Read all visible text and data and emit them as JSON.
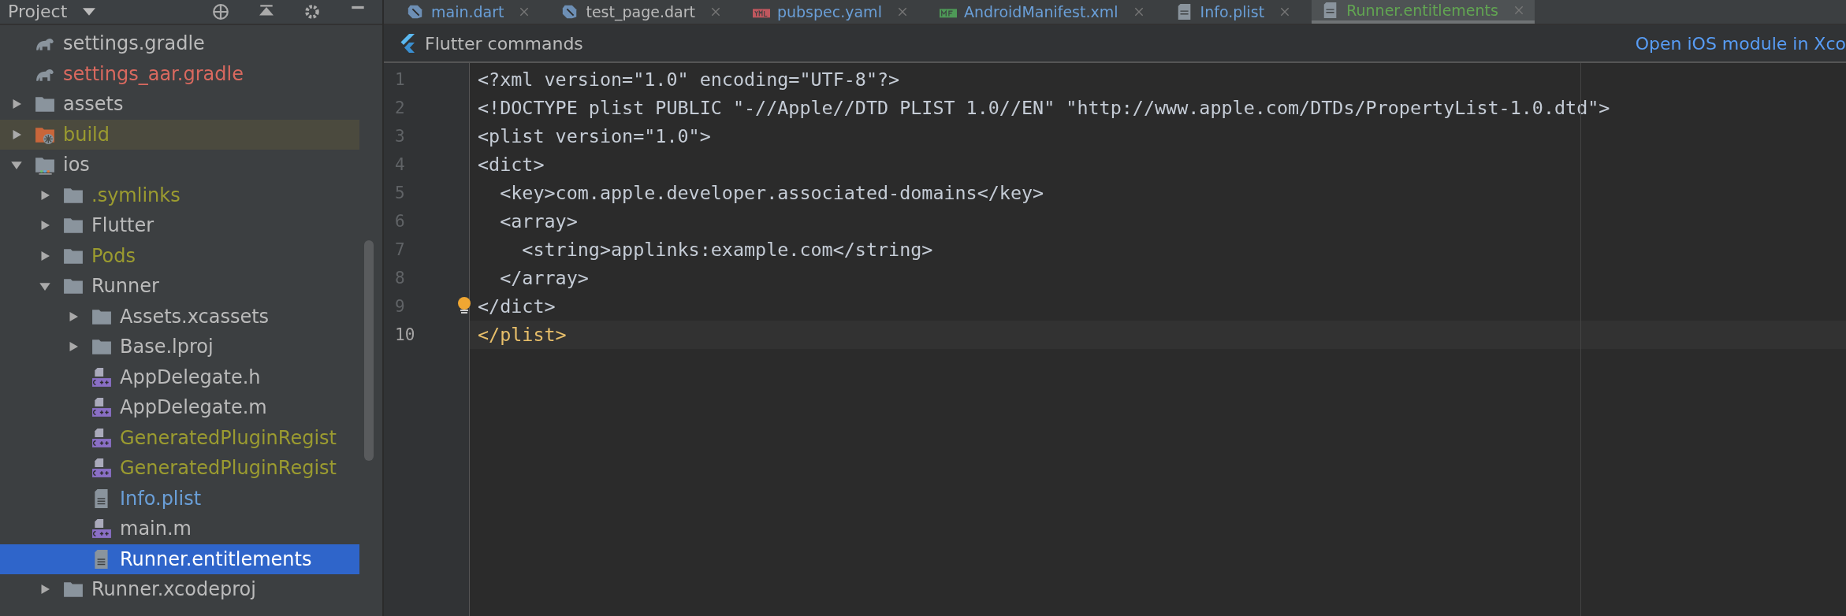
{
  "sidebar": {
    "title": "Project",
    "tree": [
      {
        "label": "settings.gradle",
        "kind": "gradle",
        "color": "#bbbbbb",
        "selected": false,
        "ignored": false
      },
      {
        "label": "settings_aar.gradle",
        "kind": "gradle",
        "color": "#d9695f",
        "selected": false,
        "ignored": false
      },
      {
        "label": "assets",
        "kind": "folder",
        "color": "#bbbbbb",
        "selected": false,
        "ignored": false,
        "expanded": false
      },
      {
        "label": "build",
        "kind": "build-folder",
        "color": "#9b9b30",
        "selected": false,
        "ignored": true,
        "expanded": false
      },
      {
        "label": "ios",
        "kind": "ios-folder",
        "color": "#bbbbbb",
        "selected": false,
        "ignored": false,
        "expanded": true,
        "children": [
          {
            "label": ".symlinks",
            "kind": "folder",
            "color": "#9b9b30",
            "selected": false,
            "ignored": false,
            "expanded": false
          },
          {
            "label": "Flutter",
            "kind": "folder",
            "color": "#bbbbbb",
            "selected": false,
            "ignored": false,
            "expanded": false
          },
          {
            "label": "Pods",
            "kind": "folder",
            "color": "#9b9b30",
            "selected": false,
            "ignored": false,
            "expanded": false
          },
          {
            "label": "Runner",
            "kind": "folder",
            "color": "#bbbbbb",
            "selected": false,
            "ignored": false,
            "expanded": true,
            "children": [
              {
                "label": "Assets.xcassets",
                "kind": "folder",
                "color": "#bbbbbb",
                "selected": false,
                "ignored": false,
                "expanded": false
              },
              {
                "label": "Base.lproj",
                "kind": "folder",
                "color": "#bbbbbb",
                "selected": false,
                "ignored": false,
                "expanded": false
              },
              {
                "label": "AppDelegate.h",
                "kind": "cpp",
                "color": "#bbbbbb",
                "selected": false,
                "ignored": false
              },
              {
                "label": "AppDelegate.m",
                "kind": "cpp",
                "color": "#bbbbbb",
                "selected": false,
                "ignored": false
              },
              {
                "label": "GeneratedPluginRegist",
                "kind": "cpp",
                "color": "#9b9b30",
                "selected": false,
                "ignored": false
              },
              {
                "label": "GeneratedPluginRegist",
                "kind": "cpp",
                "color": "#9b9b30",
                "selected": false,
                "ignored": false
              },
              {
                "label": "Info.plist",
                "kind": "plist",
                "color": "#6a9fd8",
                "selected": false,
                "ignored": false
              },
              {
                "label": "main.m",
                "kind": "cpp",
                "color": "#bbbbbb",
                "selected": false,
                "ignored": false
              },
              {
                "label": "Runner.entitlements",
                "kind": "plist",
                "color": "#ffffff",
                "selected": true,
                "ignored": false
              }
            ]
          },
          {
            "label": "Runner.xcodeproj",
            "kind": "folder",
            "color": "#bbbbbb",
            "selected": false,
            "ignored": false,
            "expanded": false
          }
        ]
      }
    ]
  },
  "tabs": [
    {
      "label": "main.dart",
      "kind": "dart",
      "color": "#6a9fd8",
      "selected": false
    },
    {
      "label": "test_page.dart",
      "kind": "dart",
      "color": "#bbbbbb",
      "selected": false
    },
    {
      "label": "pubspec.yaml",
      "kind": "yml",
      "color": "#6a9fd8",
      "selected": false
    },
    {
      "label": "AndroidManifest.xml",
      "kind": "mf",
      "color": "#6a9fd8",
      "selected": false
    },
    {
      "label": "Info.plist",
      "kind": "file",
      "color": "#6a9fd8",
      "selected": false
    },
    {
      "label": "Runner.entitlements",
      "kind": "file",
      "color": "#62a552",
      "selected": true
    }
  ],
  "flutter_bar": {
    "title": "Flutter commands",
    "link": "Open iOS module in Xco"
  },
  "editor": {
    "lines": [
      {
        "number": "1",
        "text": "<?xml version=\"1.0\" encoding=\"UTF-8\"?>",
        "current": false
      },
      {
        "number": "2",
        "text": "<!DOCTYPE plist PUBLIC \"-//Apple//DTD PLIST 1.0//EN\" \"http://www.apple.com/DTDs/PropertyList-1.0.dtd\">",
        "current": false
      },
      {
        "number": "3",
        "text": "<plist version=\"1.0\">",
        "current": false
      },
      {
        "number": "4",
        "text": "<dict>",
        "current": false
      },
      {
        "number": "5",
        "text": "  <key>com.apple.developer.associated-domains</key>",
        "current": false
      },
      {
        "number": "6",
        "text": "  <array>",
        "current": false
      },
      {
        "number": "7",
        "text": "    <string>applinks:example.com</string>",
        "current": false
      },
      {
        "number": "8",
        "text": "  </array>",
        "current": false
      },
      {
        "number": "9",
        "text": "</dict>",
        "current": false
      },
      {
        "number": "10",
        "text": "</plist>",
        "current": true
      }
    ]
  }
}
